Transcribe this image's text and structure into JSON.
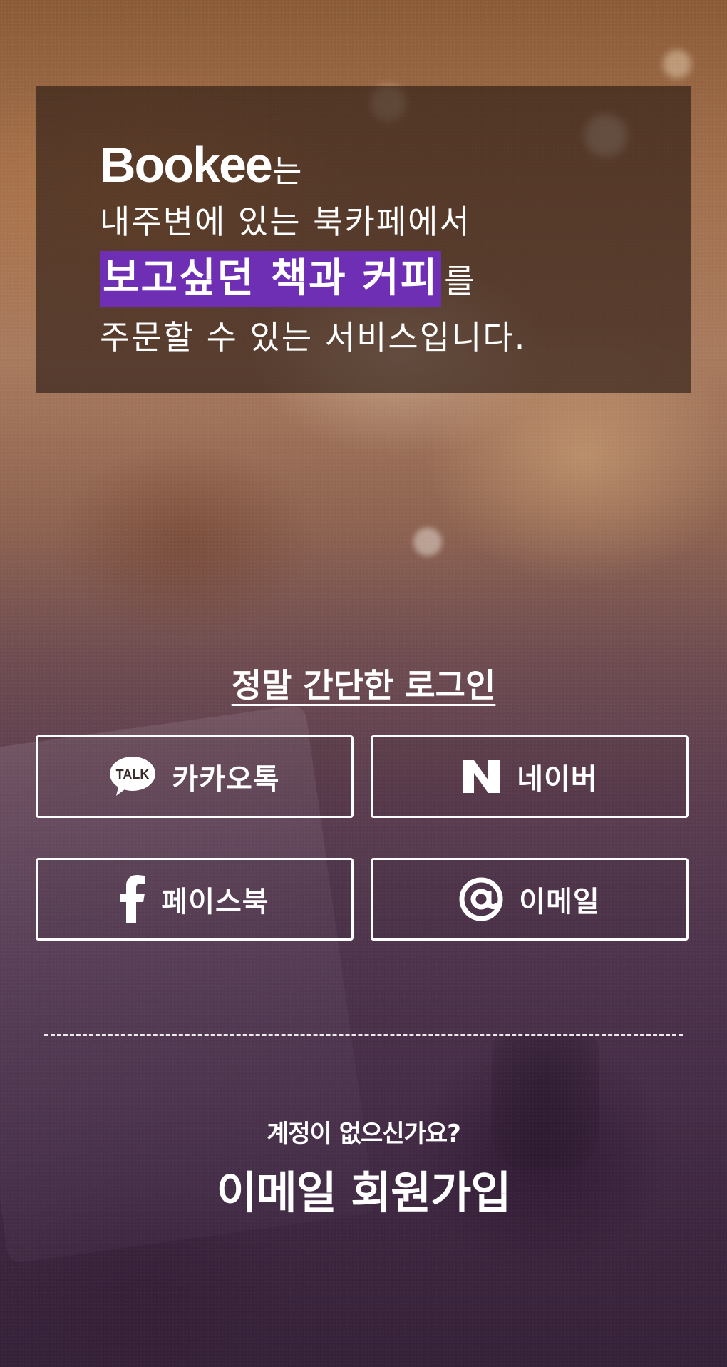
{
  "intro": {
    "brand": "Bookee",
    "brand_suffix": "는",
    "line2": "내주변에 있는 북카페에서",
    "highlight": "보고싶던 책과 커피",
    "highlight_suffix": "를",
    "line4": "주문할 수 있는 서비스입니다."
  },
  "login": {
    "title": "정말 간단한 로그인",
    "kakao_icon_text": "TALK",
    "kakao_label": "카카오톡",
    "naver_label": "네이버",
    "facebook_label": "페이스북",
    "email_label": "이메일"
  },
  "signup": {
    "question": "계정이 없으신가요?",
    "link": "이메일 회원가입"
  },
  "colors": {
    "highlight": "#6f2fb5",
    "text": "#ffffff"
  },
  "icons": [
    "kakao-talk-icon",
    "naver-icon",
    "facebook-icon",
    "at-sign-icon"
  ]
}
